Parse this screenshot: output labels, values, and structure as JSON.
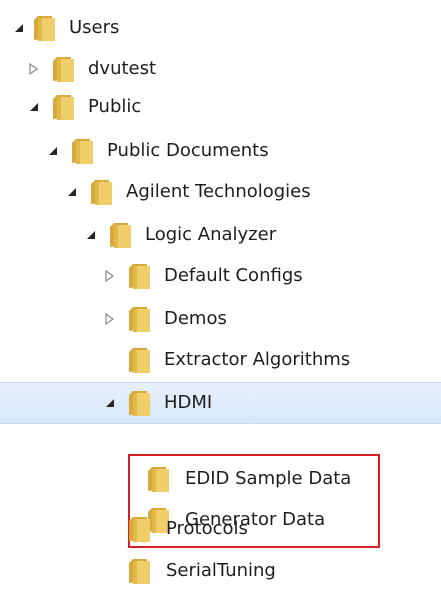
{
  "tree": {
    "items": [
      {
        "label": "Users",
        "state": "expanded"
      },
      {
        "label": "dvutest",
        "state": "collapsed"
      },
      {
        "label": "Public",
        "state": "expanded"
      },
      {
        "label": "Public Documents",
        "state": "expanded"
      },
      {
        "label": "Agilent Technologies",
        "state": "expanded"
      },
      {
        "label": "Logic Analyzer",
        "state": "expanded"
      },
      {
        "label": "Default Configs",
        "state": "collapsed"
      },
      {
        "label": "Demos",
        "state": "collapsed"
      },
      {
        "label": "Extractor Algorithms",
        "state": "leaf"
      },
      {
        "label": "HDMI",
        "state": "expanded",
        "selected": true
      },
      {
        "label": "EDID Sample Data",
        "state": "leaf"
      },
      {
        "label": "Generator Data",
        "state": "leaf"
      },
      {
        "label": "Protocols",
        "state": "leaf"
      },
      {
        "label": "SerialTuning",
        "state": "leaf"
      }
    ],
    "icons": {
      "expanded": "expanded-arrow-icon",
      "collapsed": "collapsed-arrow-icon",
      "folder": "folder-icon"
    }
  },
  "colors": {
    "selection": "#d6e7f8",
    "highlight_border": "#d21f25",
    "folder": "#e8c45a",
    "text": "#1e1e1e"
  }
}
